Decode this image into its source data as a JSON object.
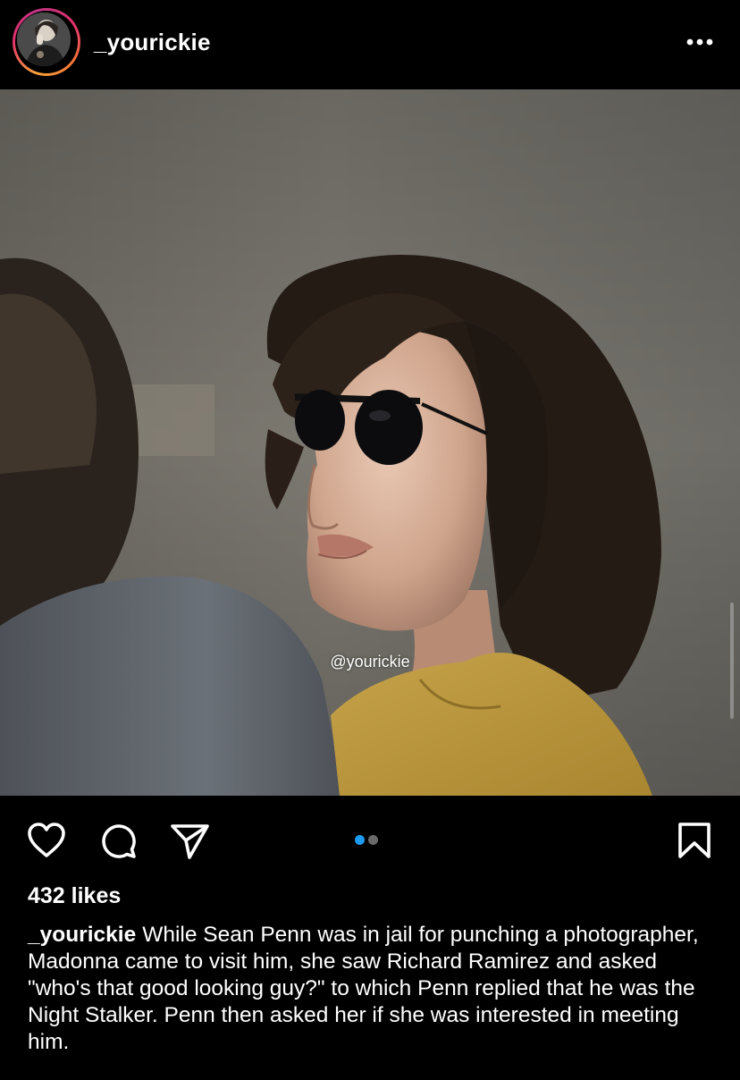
{
  "post": {
    "username": "_yourickie",
    "watermark": "@yourickie",
    "likes": "432 likes",
    "caption_user": "_yourickie",
    "caption_text": "While Sean Penn was in jail for punching a photographer, Madonna came to visit him, she saw Richard Ramirez and asked \"who's that good looking guy?\" to which Penn replied that he was the Night Stalker. Penn then asked her if she was interested in meeting him.",
    "carousel": {
      "count": 2,
      "active": 1
    }
  },
  "icons": {
    "more": "more-horizontal-icon",
    "like": "heart-icon",
    "comment": "comment-icon",
    "share": "paper-plane-icon",
    "save": "bookmark-icon"
  },
  "colors": {
    "background": "#000000",
    "text": "#ffffff",
    "active_dot": "#1d9bf0",
    "inactive_dot": "#6a6a6a"
  }
}
